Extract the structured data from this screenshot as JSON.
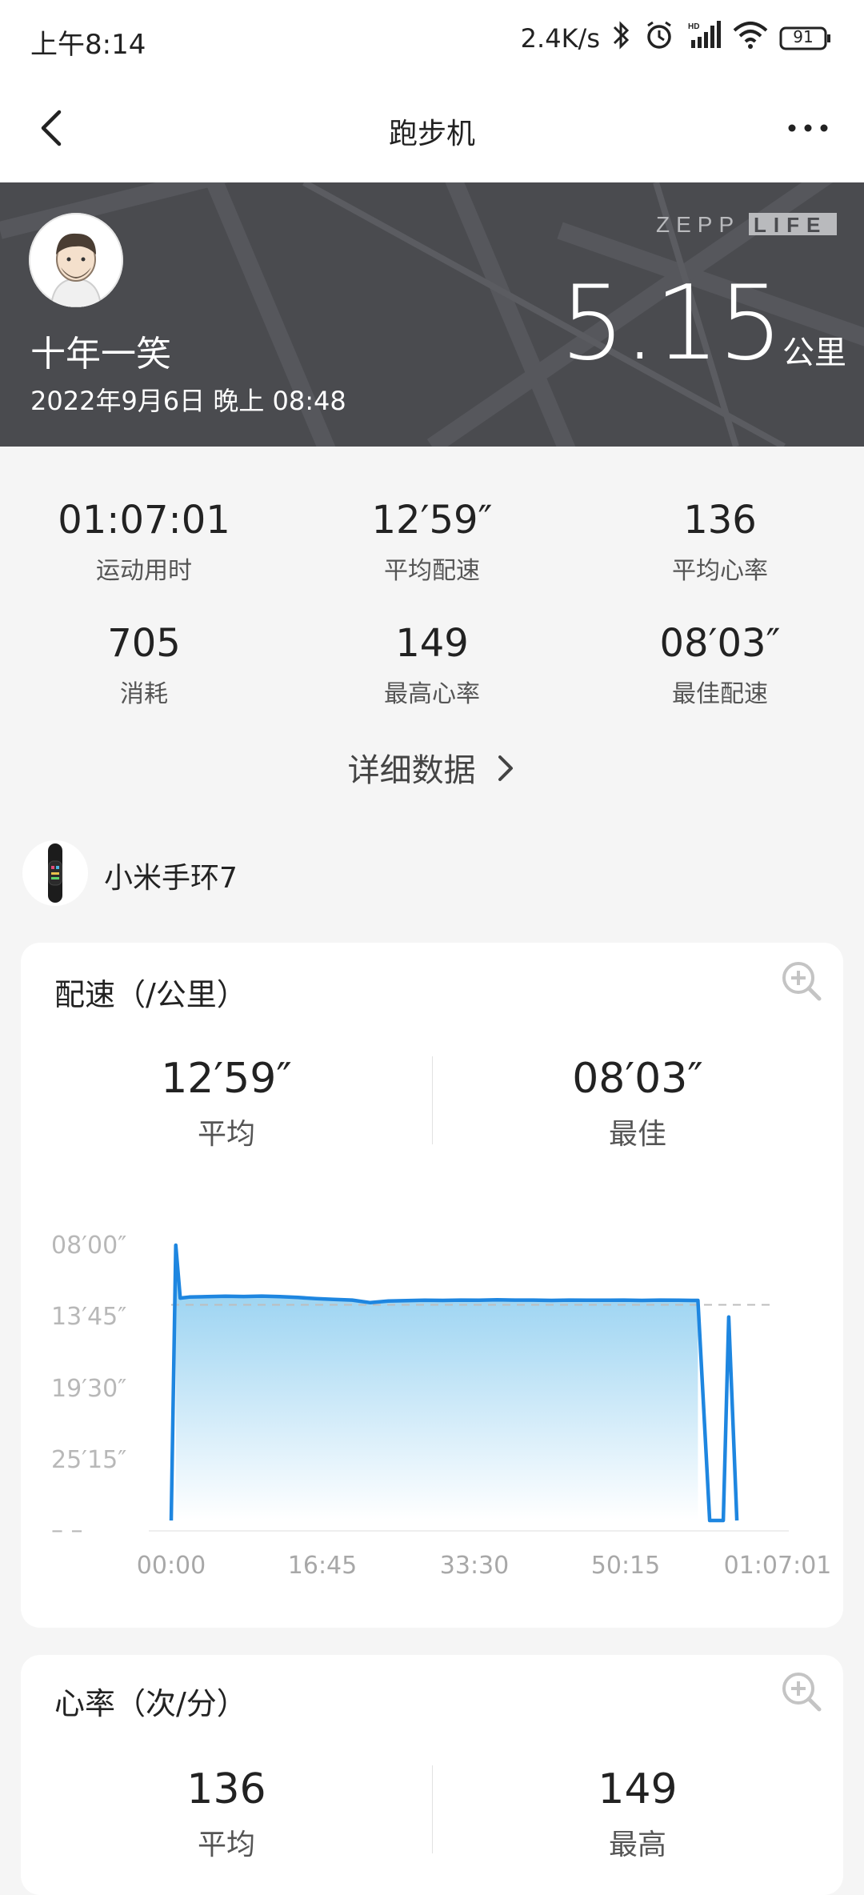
{
  "status": {
    "time": "上午8:14",
    "net_speed": "2.4K/s",
    "battery": "91"
  },
  "appbar": {
    "title": "跑步机"
  },
  "header": {
    "username": "十年一笑",
    "datetime": "2022年9月6日 晚上 08:48",
    "distance": "5.15",
    "distance_unit": "公里",
    "brand": "ZEPP LIFE"
  },
  "stats": [
    {
      "value": "01:07:01",
      "label": "运动用时"
    },
    {
      "value": "12′59″",
      "label": "平均配速"
    },
    {
      "value": "136",
      "label": "平均心率"
    },
    {
      "value": "705",
      "label": "消耗"
    },
    {
      "value": "149",
      "label": "最高心率"
    },
    {
      "value": "08′03″",
      "label": "最佳配速"
    }
  ],
  "detail_link": "详细数据",
  "device": {
    "name": "小米手环7"
  },
  "pace_card": {
    "title": "配速（/公里）",
    "avg_value": "12′59″",
    "avg_label": "平均",
    "best_value": "08′03″",
    "best_label": "最佳"
  },
  "hr_card": {
    "title": "心率（次/分）",
    "avg_value": "136",
    "avg_label": "平均",
    "max_value": "149",
    "max_label": "最高"
  },
  "chart_data": {
    "type": "area",
    "title": "配速（/公里）",
    "y_tick_labels": [
      "08′00″",
      "13′45″",
      "19′30″",
      "25′15″",
      "– –"
    ],
    "x_tick_labels": [
      "00:00",
      "16:45",
      "33:30",
      "50:15",
      "01:07:01"
    ],
    "y_inverted": true,
    "ylim_sec_per_km": [
      480,
      1860
    ],
    "xlim_min": [
      0,
      67
    ],
    "avg_line_sec_per_km": 779,
    "x_min": [
      0,
      0.5,
      1,
      2,
      4,
      6,
      8,
      10,
      12,
      14,
      16,
      18,
      20,
      22,
      24,
      26,
      28,
      30,
      32,
      34,
      36,
      38,
      40,
      42,
      44,
      46,
      48,
      50,
      52,
      54,
      56,
      57.5,
      58.2,
      59.5,
      60,
      61,
      61.6,
      62.5
    ],
    "y_sec_per_km": [
      1860,
      480,
      745,
      740,
      738,
      736,
      737,
      735,
      738,
      742,
      748,
      752,
      755,
      768,
      760,
      758,
      756,
      757,
      755,
      756,
      754,
      755,
      755,
      757,
      755,
      756,
      756,
      755,
      757,
      755,
      756,
      757,
      757,
      1860,
      1860,
      1860,
      840,
      1860
    ],
    "grid": false,
    "colors": {
      "line": "#1e86e0",
      "fill_top": "#88cbef",
      "fill_bottom": "#ffffff",
      "avg_line": "#bdbdbd"
    }
  }
}
